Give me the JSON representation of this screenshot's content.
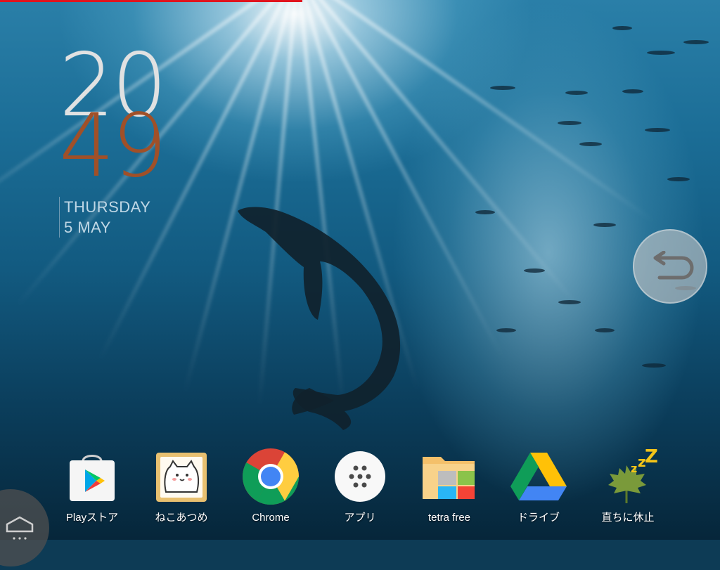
{
  "status": {
    "progress_fraction": 0.42,
    "progress_color": "#e1141e"
  },
  "clock": {
    "hours": "20",
    "minutes": "49",
    "hours_color": "#e1e1e1",
    "minutes_color": "#a05028",
    "day": "THURSDAY",
    "date": "5 MAY"
  },
  "overlay": {
    "back_icon": "return-arrow-icon"
  },
  "dock": {
    "apps": [
      {
        "label": "Playストア",
        "icon": "play-store-icon"
      },
      {
        "label": "ねこあつめ",
        "icon": "neko-atsume-icon"
      },
      {
        "label": "Chrome",
        "icon": "chrome-icon"
      },
      {
        "label": "アプリ",
        "icon": "app-drawer-icon"
      },
      {
        "label": "tetra free",
        "icon": "tetra-folder-icon"
      },
      {
        "label": "ドライブ",
        "icon": "google-drive-icon"
      },
      {
        "label": "直ちに休止",
        "icon": "sleep-leaf-icon"
      }
    ]
  }
}
